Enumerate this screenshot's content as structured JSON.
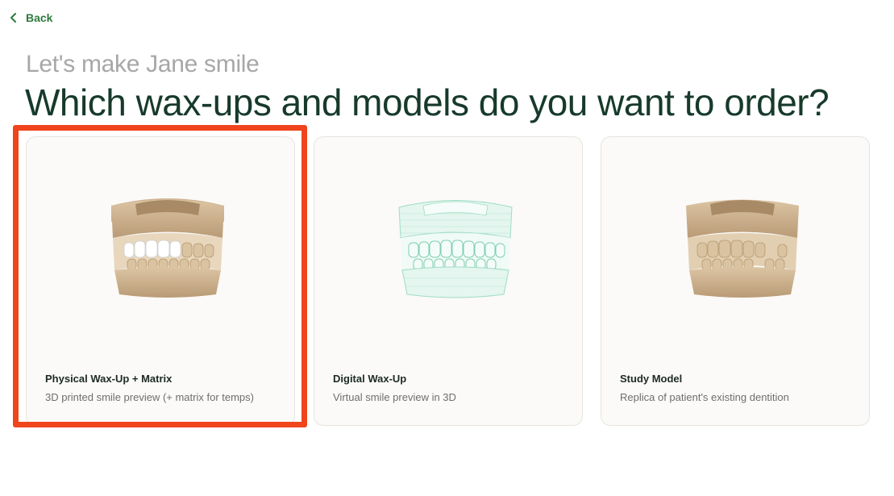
{
  "nav": {
    "back_label": "Back"
  },
  "header": {
    "subtitle": "Let's make Jane smile",
    "title": "Which wax-ups and models do you want to order?"
  },
  "colors": {
    "accent": "#2f7a3f",
    "title": "#173a2b",
    "highlight": "#f0441d",
    "card_bg": "#fbfaf8"
  },
  "cards": [
    {
      "title": "Physical Wax-Up + Matrix",
      "description": "3D printed smile preview (+ matrix for temps)",
      "icon": "physical-waxup-model-icon",
      "selected": true
    },
    {
      "title": "Digital Wax-Up",
      "description": "Virtual smile preview in 3D",
      "icon": "digital-waxup-model-icon",
      "selected": false
    },
    {
      "title": "Study Model",
      "description": "Replica of patient's existing dentition",
      "icon": "study-model-icon",
      "selected": false
    }
  ]
}
